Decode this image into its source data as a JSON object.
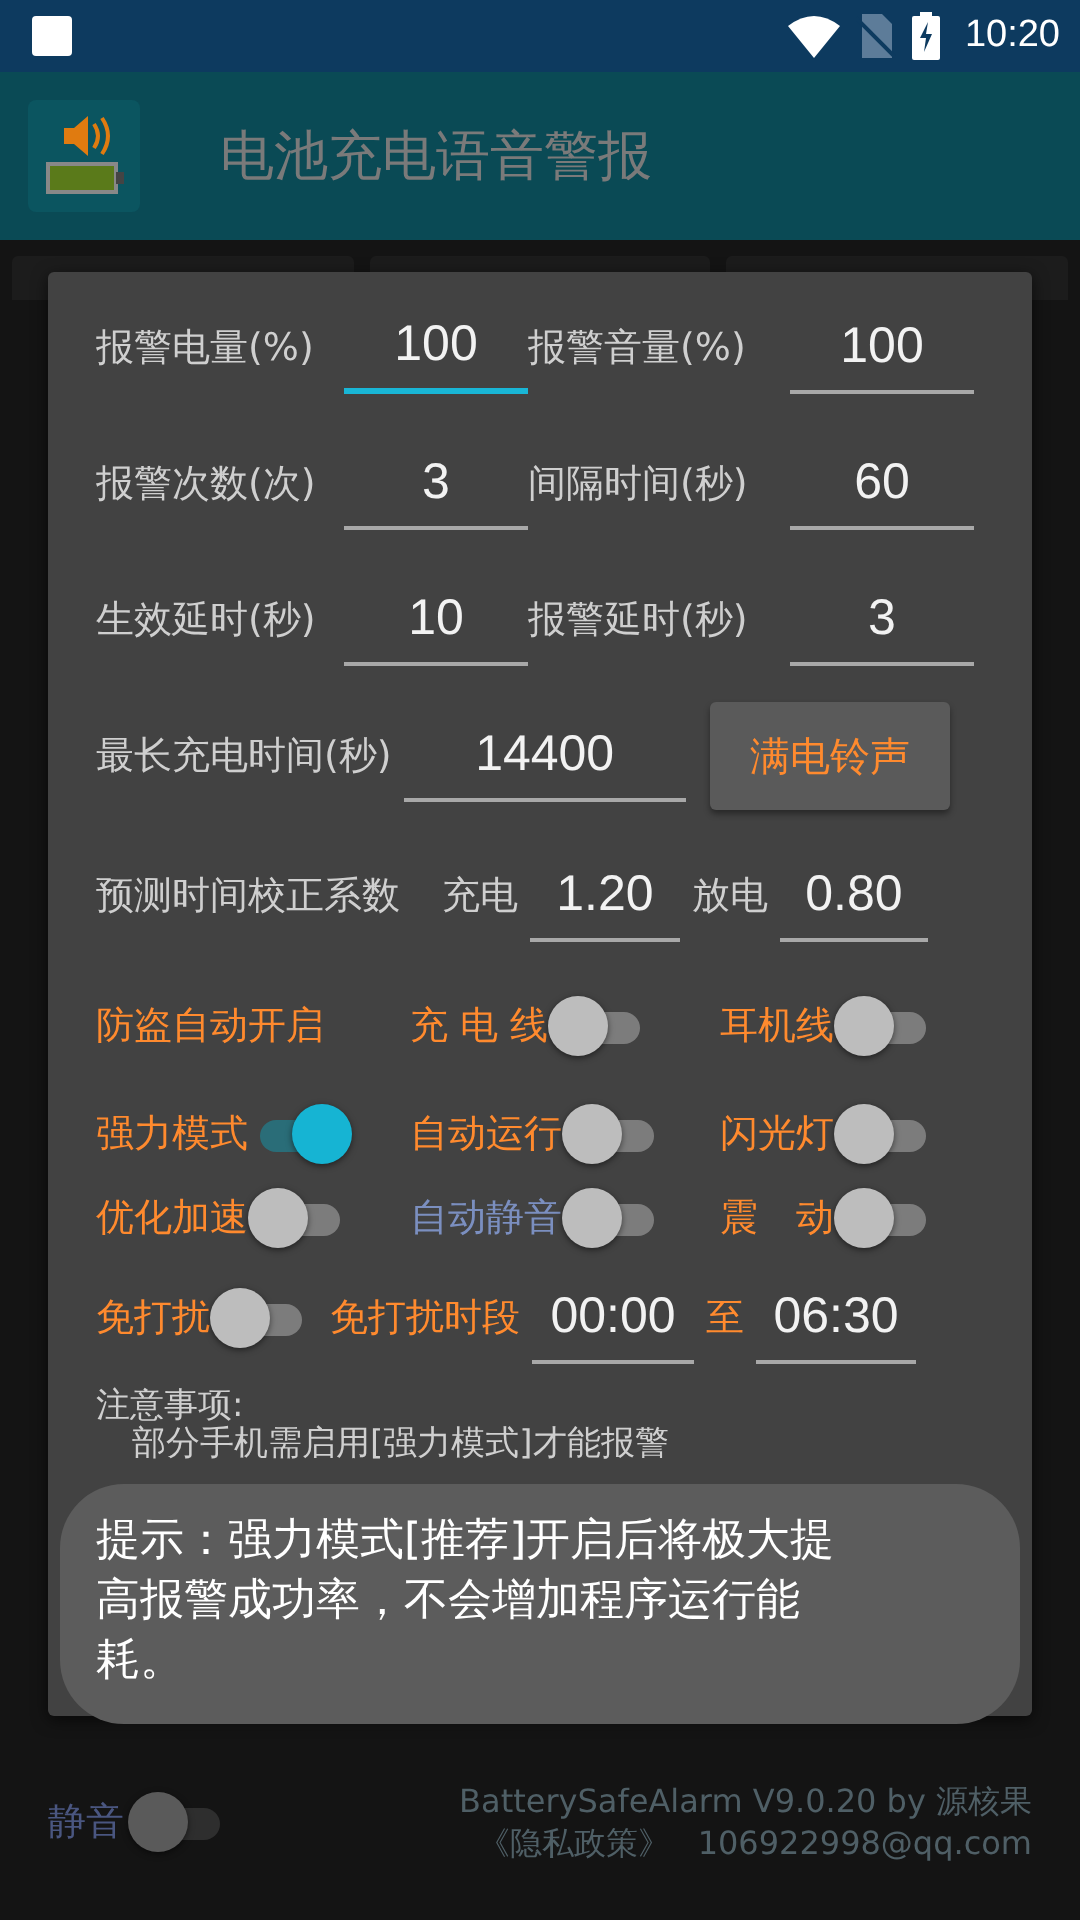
{
  "status_bar": {
    "time": "10:20"
  },
  "app_bar": {
    "title": "电池充电语音警报"
  },
  "dialog": {
    "field_rows": [
      {
        "cells": [
          {
            "label": "报警电量(%)",
            "value": "100",
            "focused": true
          },
          {
            "label": "报警音量(%)",
            "value": "100",
            "focused": false
          }
        ]
      },
      {
        "cells": [
          {
            "label": "报警次数(次)",
            "value": "3",
            "focused": false
          },
          {
            "label": "间隔时间(秒)",
            "value": "60",
            "focused": false
          }
        ]
      },
      {
        "cells": [
          {
            "label": "生效延时(秒)",
            "value": "10",
            "focused": false
          },
          {
            "label": "报警延时(秒)",
            "value": "3",
            "focused": false
          }
        ]
      }
    ],
    "max_charge": {
      "label": "最长充电时间(秒)",
      "value": "14400",
      "button": "满电铃声"
    },
    "correction": {
      "label": "预测时间校正系数",
      "charge_label": "充电",
      "charge_value": "1.20",
      "discharge_label": "放电",
      "discharge_value": "0.80"
    },
    "switch_rows": [
      {
        "items": [
          {
            "kind": "heading",
            "label": "防盗自动开启"
          },
          {
            "kind": "switch",
            "label": "充 电 线",
            "on": false,
            "disabled": false
          },
          {
            "kind": "switch",
            "label": "耳机线",
            "on": false,
            "disabled": false
          }
        ]
      },
      {
        "items": [
          {
            "kind": "switch",
            "label": "强力模式",
            "on": true,
            "disabled": false
          },
          {
            "kind": "switch",
            "label": "自动运行",
            "on": false,
            "disabled": false
          },
          {
            "kind": "switch",
            "label": "闪光灯",
            "on": false,
            "disabled": false
          }
        ]
      },
      {
        "items": [
          {
            "kind": "switch",
            "label": "优化加速",
            "on": false,
            "disabled": false
          },
          {
            "kind": "switch",
            "label": "自动静音",
            "on": false,
            "disabled": true
          },
          {
            "kind": "switch",
            "label": "震　动",
            "on": false,
            "disabled": false
          }
        ]
      }
    ],
    "dnd": {
      "label": "免打扰",
      "on": false,
      "period_label": "免打扰时段",
      "start": "00:00",
      "to": "至",
      "end": "06:30"
    },
    "notes": {
      "title": "注意事项:",
      "lines": [
        "部分手机需启用[强力模式]才能报警"
      ]
    }
  },
  "toast": "提示：强力模式[推荐]开启后将极大提高报警成功率，不会增加程序运行能耗。",
  "footer": {
    "mute": {
      "label": "静音",
      "on": false
    },
    "version": "BatterySafeAlarm V9.0.20 by 源核果",
    "privacy": "《隐私政策》",
    "email": "106922998@qq.com"
  }
}
